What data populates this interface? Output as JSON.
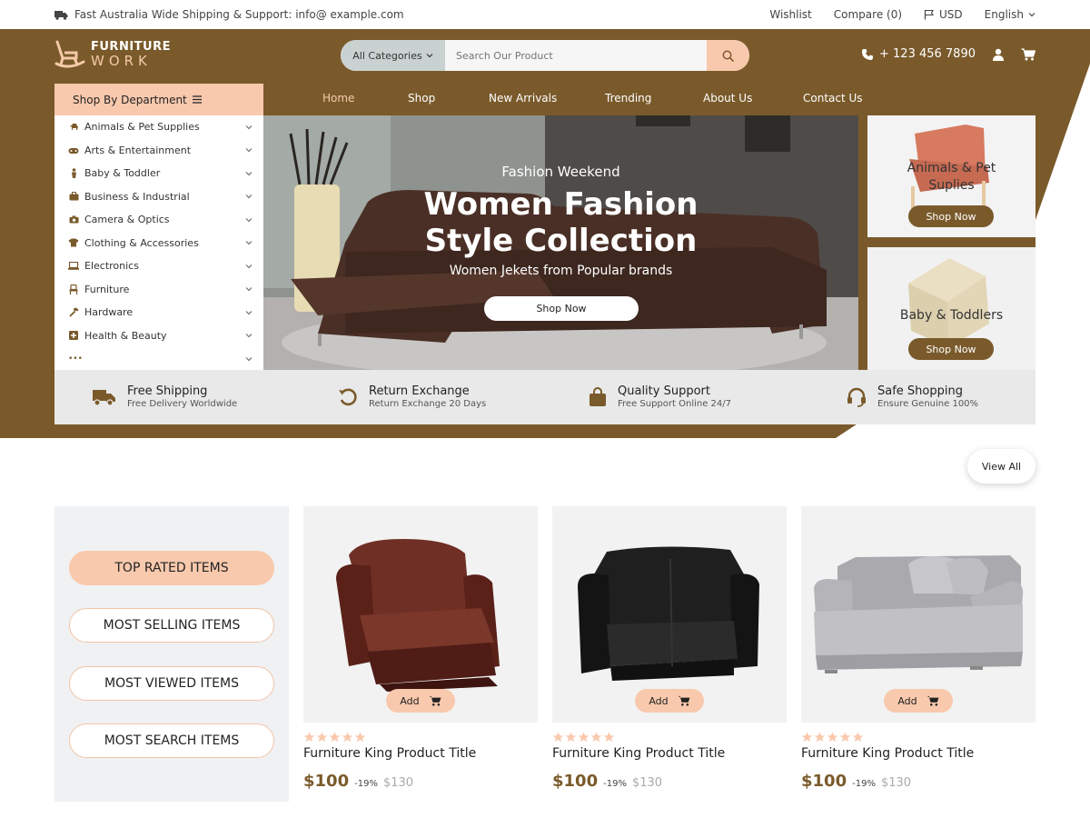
{
  "topbar": {
    "shipping_text": "Fast Australia Wide Shipping & Support: info@ example.com",
    "wishlist": "Wishlist",
    "compare": "Compare (0)",
    "currency": "USD",
    "language": "English"
  },
  "logo": {
    "line1": "FURNITURE",
    "line2": "WORK"
  },
  "search": {
    "category_label": "All Categories",
    "placeholder": "Search Our Product",
    "icon": "search-icon"
  },
  "header": {
    "phone": "+ 123 456 7890",
    "icons": [
      "phone-icon",
      "user-icon",
      "cart-icon"
    ]
  },
  "department": {
    "title": "Shop By Department",
    "items": [
      {
        "label": "Animals & Pet Supplies",
        "icon": "paw-icon"
      },
      {
        "label": "Arts & Entertainment",
        "icon": "gamepad-icon"
      },
      {
        "label": "Baby & Toddler",
        "icon": "baby-icon"
      },
      {
        "label": "Business & Industrial",
        "icon": "briefcase-icon"
      },
      {
        "label": "Camera & Optics",
        "icon": "camera-icon"
      },
      {
        "label": "Clothing & Accessories",
        "icon": "shirt-icon"
      },
      {
        "label": "Electronics",
        "icon": "laptop-icon"
      },
      {
        "label": "Furniture",
        "icon": "chair-icon"
      },
      {
        "label": "Hardware",
        "icon": "hammer-icon"
      },
      {
        "label": "Health & Beauty",
        "icon": "plus-box-icon"
      },
      {
        "label": "•••",
        "icon": "more-icon"
      }
    ]
  },
  "nav": {
    "items": [
      "Home",
      "Shop",
      "New Arrivals",
      "Trending",
      "About Us",
      "Contact Us"
    ],
    "active": "Home"
  },
  "hero": {
    "kicker": "Fashion Weekend",
    "title_line1": "Women Fashion",
    "title_line2": "Style Collection",
    "subtitle": "Women Jekets from  Popular brands",
    "button": "Shop Now"
  },
  "promos": [
    {
      "title_line1": "Animals & Pet",
      "title_line2": "Suplies",
      "button": "Shop Now"
    },
    {
      "title_line1": "Baby & Toddlers",
      "title_line2": "",
      "button": "Shop Now"
    }
  ],
  "features": [
    {
      "title": "Free Shipping",
      "subtitle": "Free Delivery Worldwide",
      "icon": "truck-icon"
    },
    {
      "title": "Return Exchange",
      "subtitle": "Return Exchange 20 Days",
      "icon": "return-icon"
    },
    {
      "title": "Quality Support",
      "subtitle": "Free Support Online 24/7",
      "icon": "bag-icon"
    },
    {
      "title": "Safe Shopping",
      "subtitle": "Ensure Genuine 100%",
      "icon": "headset-icon"
    }
  ],
  "view_all": "View All",
  "product_tabs": {
    "items": [
      "TOP RATED ITEMS",
      "MOST SELLING ITEMS",
      "MOST VIEWED ITEMS",
      "MOST SEARCH ITEMS"
    ],
    "active": "TOP RATED ITEMS"
  },
  "products": [
    {
      "title": "Furniture King Product Title",
      "price": "$100",
      "discount": "-19%",
      "old_price": "$130",
      "add_label": "Add",
      "rating": 5
    },
    {
      "title": "Furniture King Product Title",
      "price": "$100",
      "discount": "-19%",
      "old_price": "$130",
      "add_label": "Add",
      "rating": 5
    },
    {
      "title": "Furniture King Product Title",
      "price": "$100",
      "discount": "-19%",
      "old_price": "$130",
      "add_label": "Add",
      "rating": 5
    }
  ],
  "colors": {
    "brand_brown": "#7a5a2b",
    "accent_peach": "#f9c9ad",
    "muted_panel": "#f0f1f3"
  }
}
